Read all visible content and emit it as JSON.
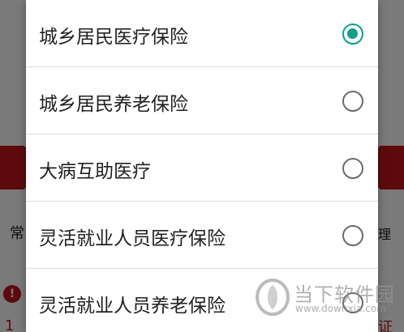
{
  "options": [
    {
      "label": "城乡居民医疗保险",
      "selected": true
    },
    {
      "label": "城乡居民养老保险",
      "selected": false
    },
    {
      "label": "大病互助医疗",
      "selected": false
    },
    {
      "label": "灵活就业人员医疗保险",
      "selected": false
    },
    {
      "label": "灵活就业人员养老保险",
      "selected": false
    }
  ],
  "background": {
    "left_text": "常",
    "right_text": "理",
    "info_icon": "info-icon",
    "left_number": "1",
    "right_bottom_text": "证"
  },
  "watermark": {
    "title": "当下软件园",
    "subtitle": "www.downxia.com"
  },
  "colors": {
    "accent": "#109d8a",
    "brand_red": "#c4161c"
  }
}
